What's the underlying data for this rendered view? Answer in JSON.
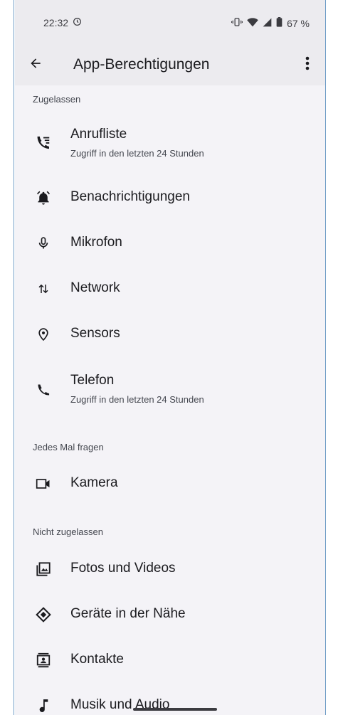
{
  "status_bar": {
    "time": "22:32",
    "battery": "67 %",
    "icons": [
      "sync-icon",
      "vibrate-icon",
      "wifi-icon",
      "signal-icon",
      "battery-icon"
    ]
  },
  "app_bar": {
    "title": "App-Berechtigungen",
    "back_icon": "arrow-back-icon",
    "more_icon": "more-vert-icon"
  },
  "sections": {
    "allowed": {
      "label": "Zugelassen",
      "items": [
        {
          "title": "Anrufliste",
          "subtitle": "Zugriff in den letzten 24 Stunden",
          "icon": "call-log-icon"
        },
        {
          "title": "Benachrichtigungen",
          "icon": "notifications-icon"
        },
        {
          "title": "Mikrofon",
          "icon": "microphone-icon"
        },
        {
          "title": "Network",
          "icon": "network-arrows-icon"
        },
        {
          "title": "Sensors",
          "icon": "location-pin-icon"
        },
        {
          "title": "Telefon",
          "subtitle": "Zugriff in den letzten 24 Stunden",
          "icon": "phone-icon"
        }
      ]
    },
    "ask": {
      "label": "Jedes Mal fragen",
      "items": [
        {
          "title": "Kamera",
          "icon": "camera-icon"
        }
      ]
    },
    "denied": {
      "label": "Nicht zugelassen",
      "items": [
        {
          "title": "Fotos und Videos",
          "icon": "photos-icon"
        },
        {
          "title": "Geräte in der Nähe",
          "icon": "nearby-devices-icon"
        },
        {
          "title": "Kontakte",
          "icon": "contacts-icon"
        },
        {
          "title": "Musik und Audio",
          "icon": "music-note-icon"
        }
      ]
    }
  },
  "colors": {
    "background": "#f4f3f7",
    "app_bar": "#ecebef",
    "text_primary": "#1b1b1f",
    "text_secondary": "#44474f"
  }
}
